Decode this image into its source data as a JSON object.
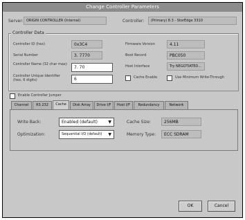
{
  "window": {
    "title": "Change Controller Parameters"
  },
  "header": {
    "server_label": "Server:",
    "server_value": "ORIGIN CONTROLLER (Internal)",
    "controller_label": "Controller:",
    "controller_value": "(Primary) 8.3 - StorEdge 3310"
  },
  "controller_data": {
    "title": "Controller Data",
    "left": [
      {
        "label": "Controller ID (hex)",
        "value": "0x3C4"
      },
      {
        "label": "Serial Number",
        "value": "3. 7770"
      },
      {
        "label": "Controller Name (32 char max)",
        "value": "7. 70"
      },
      {
        "label": "Controller Unique Identifier (hex, 6 digits)",
        "value": "6"
      }
    ],
    "right": [
      {
        "label": "Firmware Version",
        "value": "4.11"
      },
      {
        "label": "Boot Record",
        "value": "PBC050"
      },
      {
        "label": "Host Interface",
        "value": "Try NEGOTIATED..."
      }
    ],
    "checkbox_1": "Cache Enable",
    "checkbox_2": "Use Minimum Write-Through",
    "checkbox_global": "Enable Controller Jumper"
  },
  "tabs": [
    "Channel",
    "RS 232",
    "Cache",
    "Disk Array",
    "Drive I/F",
    "Host I/F",
    "Redundancy",
    "Network"
  ],
  "cache_tab": {
    "write_policy_label": "Write Back:",
    "write_policy_value": "Enabled (default)",
    "optimization_label": "Optimization:",
    "optimization_value": "Sequential I/O (default)",
    "cache_size_label": "Cache Size:",
    "cache_size_value": "256MB",
    "memory_type_label": "Memory Type:",
    "memory_type_value": "ECC SDRAM"
  },
  "buttons": {
    "ok": "OK",
    "cancel": "Cancel"
  },
  "icons": {
    "dropdown": "chevron-down-icon"
  }
}
